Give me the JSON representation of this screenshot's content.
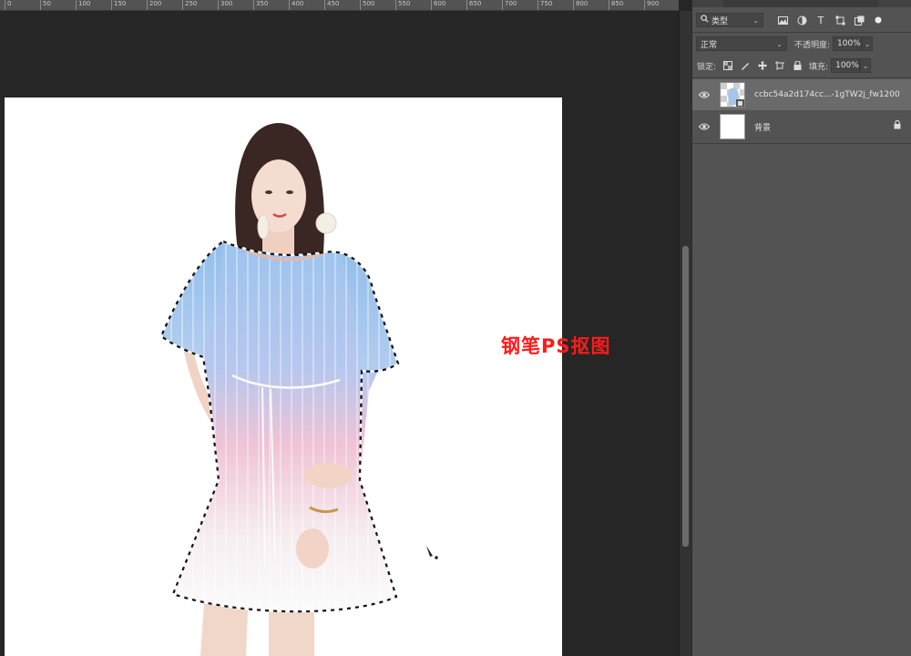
{
  "ruler": {
    "ticks": [
      "0",
      "50",
      "100",
      "150",
      "200",
      "250",
      "300",
      "350",
      "400",
      "450",
      "500",
      "550",
      "600",
      "650",
      "700",
      "750",
      "800",
      "850",
      "900"
    ]
  },
  "canvas": {
    "overlay_text": "钢笔PS抠图",
    "colors": {
      "document_bg": "#ffffff",
      "overlay_text": "#ff1a1a"
    }
  },
  "layers_panel": {
    "filter": {
      "icon": "search-icon",
      "label": "类型"
    },
    "filter_icons": [
      "image-filter-icon",
      "adjustment-filter-icon",
      "type-filter-icon",
      "shape-filter-icon",
      "smart-object-filter-icon",
      "filter-toggle-icon"
    ],
    "blend_mode": "正常",
    "opacity_label": "不透明度:",
    "opacity_value": "100%",
    "lock_label": "锁定:",
    "fill_label": "填充:",
    "fill_value": "100%",
    "layers": [
      {
        "name": "ccbc54a2d174cc...-1gTW2j_fw1200",
        "visible": true,
        "selected": true,
        "locked": false
      },
      {
        "name": "背景",
        "visible": true,
        "selected": false,
        "locked": true
      }
    ]
  }
}
